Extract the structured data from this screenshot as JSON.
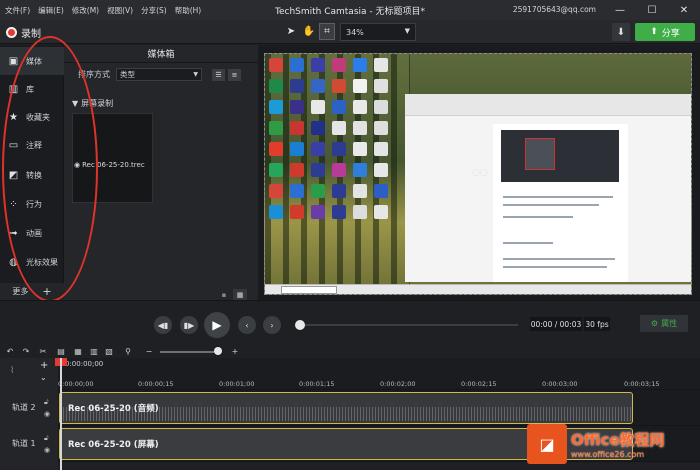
{
  "menu": {
    "items": [
      "文件(F)",
      "编辑(E)",
      "修改(M)",
      "视图(V)",
      "分享(S)",
      "帮助(H)"
    ],
    "title": "TechSmith Camtasia - 无标题项目*",
    "account": "2591705643@qq.com",
    "window_buttons": [
      "—",
      "☐",
      "✕"
    ]
  },
  "toolbar": {
    "record_label": "录制",
    "zoom_value": "34%",
    "share_label": "分享",
    "accent_color": "#3fae49"
  },
  "sidebar": {
    "items": [
      {
        "label": "媒体",
        "icon": "film-icon"
      },
      {
        "label": "库",
        "icon": "library-icon"
      },
      {
        "label": "收藏夹",
        "icon": "star-icon"
      },
      {
        "label": "注释",
        "icon": "annotation-icon"
      },
      {
        "label": "转换",
        "icon": "transition-icon"
      },
      {
        "label": "行为",
        "icon": "behavior-icon"
      },
      {
        "label": "动画",
        "icon": "animation-icon"
      },
      {
        "label": "光标效果",
        "icon": "cursor-effect-icon"
      }
    ],
    "more_label": "更多"
  },
  "mediabin": {
    "title": "媒体箱",
    "sort_label": "排序方式",
    "sort_value": "类型",
    "section_label": "屏幕录制",
    "media_item": "Rec 06-25-20.trec"
  },
  "playback": {
    "time": "00:00 / 00:03",
    "fps": "30 fps",
    "properties_label": "属性"
  },
  "timeline": {
    "playhead_time": "0:00:00;00",
    "ticks": [
      "0:00:00;00",
      "0:00:00;15",
      "0:00:01;00",
      "0:00:01;15",
      "0:00:02;00",
      "0:00:02;15",
      "0:00:03;00",
      "0:00:03;15"
    ],
    "tracks": [
      {
        "label": "轨道 2",
        "clip": "Rec 06-25-20 (音频)"
      },
      {
        "label": "轨道 1",
        "clip": "Rec 06-25-20 (屏幕)"
      }
    ]
  },
  "watermark": {
    "title": "Office教程网",
    "url": "www.office26.com"
  }
}
